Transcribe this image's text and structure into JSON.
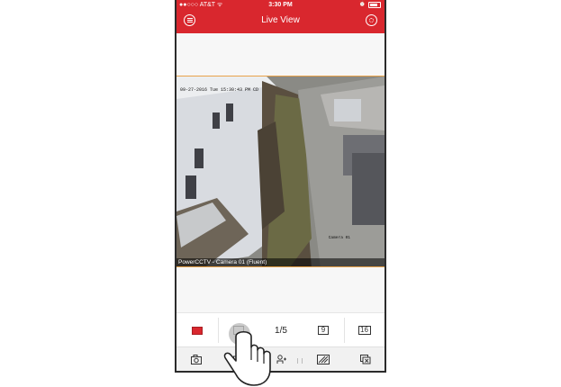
{
  "status_bar": {
    "carrier": "●●○○○ AT&T ᯤ",
    "time": "3:30 PM"
  },
  "nav": {
    "title": "Live View",
    "menu_icon": "menu-icon",
    "settings_icon": "gear-icon"
  },
  "video": {
    "osd_timestamp": "09-27-2016 Tue 15:30:43 PM CD",
    "camera_overlay": "Camera 01",
    "caption": "PowerCCTV - Camera 01 (Fluent)"
  },
  "layout_bar": {
    "page_indicator": "1/5",
    "grid9_label": "9",
    "grid16_label": "16"
  },
  "toolbar": {
    "icons": [
      "camera-icon",
      "record-icon",
      "ptz-icon",
      "fisheye-icon",
      "close-channel-icon"
    ]
  },
  "colors": {
    "accent": "#d9272e",
    "video_border": "#e9a34a"
  }
}
